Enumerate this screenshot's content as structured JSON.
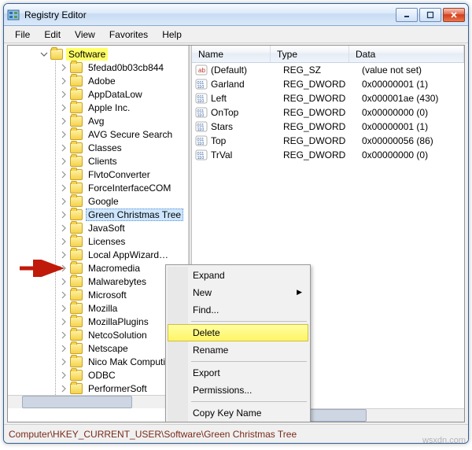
{
  "window": {
    "title": "Registry Editor"
  },
  "menubar": {
    "items": [
      "File",
      "Edit",
      "View",
      "Favorites",
      "Help"
    ]
  },
  "tree": {
    "root_label": "Software",
    "items": [
      {
        "label": "5fedad0b03cb844"
      },
      {
        "label": "Adobe"
      },
      {
        "label": "AppDataLow"
      },
      {
        "label": "Apple Inc."
      },
      {
        "label": "Avg"
      },
      {
        "label": "AVG Secure Search"
      },
      {
        "label": "Classes"
      },
      {
        "label": "Clients"
      },
      {
        "label": "FlvtoConverter"
      },
      {
        "label": "ForceInterfaceCOM"
      },
      {
        "label": "Google"
      },
      {
        "label": "Green Christmas Tree",
        "selected": true
      },
      {
        "label": "JavaSoft"
      },
      {
        "label": "Licenses"
      },
      {
        "label": "Local AppWizard…"
      },
      {
        "label": "Macromedia"
      },
      {
        "label": "Malwarebytes"
      },
      {
        "label": "Microsoft"
      },
      {
        "label": "Mozilla"
      },
      {
        "label": "MozillaPlugins"
      },
      {
        "label": "NetcoSolution"
      },
      {
        "label": "Netscape"
      },
      {
        "label": "Nico Mak Computing"
      },
      {
        "label": "ODBC"
      },
      {
        "label": "PerformerSoft"
      }
    ]
  },
  "list": {
    "columns": {
      "name": "Name",
      "type": "Type",
      "data": "Data"
    },
    "rows": [
      {
        "icon": "str",
        "name": "(Default)",
        "type": "REG_SZ",
        "data": "(value not set)"
      },
      {
        "icon": "bin",
        "name": "Garland",
        "type": "REG_DWORD",
        "data": "0x00000001 (1)"
      },
      {
        "icon": "bin",
        "name": "Left",
        "type": "REG_DWORD",
        "data": "0x000001ae (430)"
      },
      {
        "icon": "bin",
        "name": "OnTop",
        "type": "REG_DWORD",
        "data": "0x00000000 (0)"
      },
      {
        "icon": "bin",
        "name": "Stars",
        "type": "REG_DWORD",
        "data": "0x00000001 (1)"
      },
      {
        "icon": "bin",
        "name": "Top",
        "type": "REG_DWORD",
        "data": "0x00000056 (86)"
      },
      {
        "icon": "bin",
        "name": "TrVal",
        "type": "REG_DWORD",
        "data": "0x00000000 (0)"
      }
    ]
  },
  "context_menu": {
    "items": [
      {
        "label": "Expand"
      },
      {
        "label": "New",
        "submenu": true
      },
      {
        "label": "Find..."
      },
      {
        "sep": true
      },
      {
        "label": "Delete",
        "highlighted": true
      },
      {
        "label": "Rename"
      },
      {
        "sep": true
      },
      {
        "label": "Export"
      },
      {
        "label": "Permissions..."
      },
      {
        "sep": true
      },
      {
        "label": "Copy Key Name"
      }
    ]
  },
  "statusbar": {
    "path": "Computer\\HKEY_CURRENT_USER\\Software\\Green Christmas Tree"
  },
  "watermark": "wsxdn.com"
}
